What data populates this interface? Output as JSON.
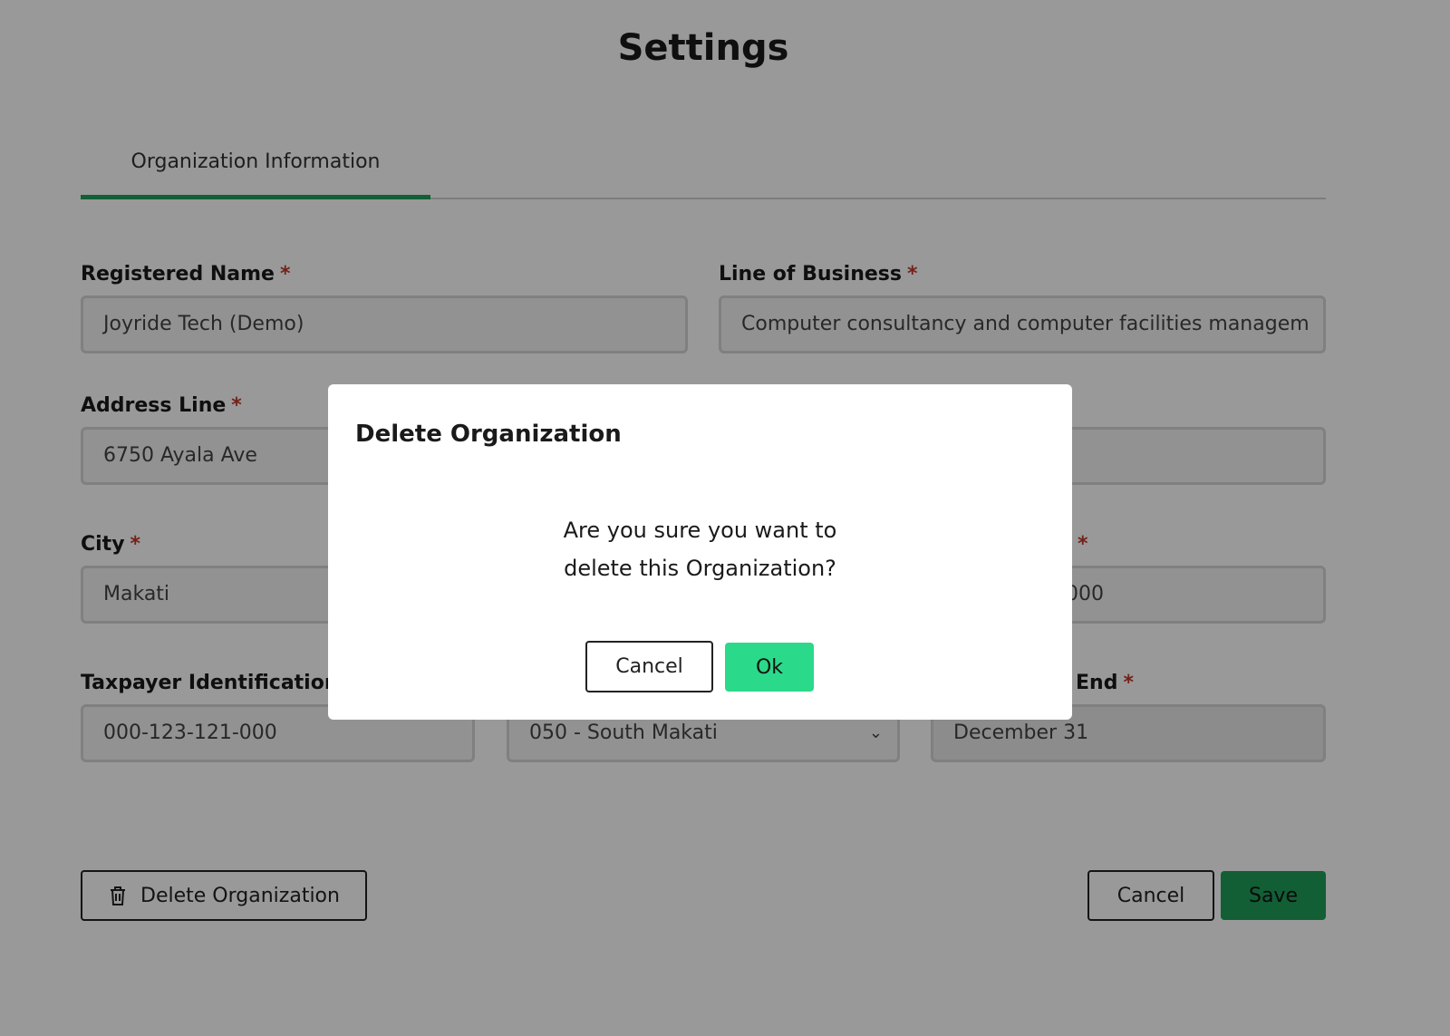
{
  "page": {
    "title": "Settings"
  },
  "tabs": [
    {
      "label": "Organization Information"
    }
  ],
  "form": {
    "registered_name": {
      "label": "Registered Name",
      "required": "*",
      "value": "Joyride Tech (Demo)"
    },
    "line_of_business": {
      "label": "Line of Business",
      "required": "*",
      "value": "Computer consultancy and computer facilities managem"
    },
    "address_line": {
      "label": "Address Line",
      "required": "*",
      "value": "6750 Ayala Ave"
    },
    "address_line_2": {
      "value": ""
    },
    "city": {
      "label": "City",
      "required": "*",
      "value": "Makati"
    },
    "zip_code": {
      "required": "*",
      "value": "000"
    },
    "tin": {
      "label": "Taxpayer Identification N",
      "value": "000-123-121-000"
    },
    "rdo": {
      "value": "050 - South Makati"
    },
    "fiscal_year_end": {
      "label": "End",
      "required": "*",
      "value": "December 31"
    }
  },
  "actions": {
    "delete_label": "Delete Organization",
    "cancel_label": "Cancel",
    "save_label": "Save"
  },
  "modal": {
    "title": "Delete Organization",
    "message_line1": "Are you sure you want to",
    "message_line2": "delete this Organization?",
    "cancel_label": "Cancel",
    "ok_label": "Ok"
  },
  "colors": {
    "accent": "#1e9e5e",
    "ok_button": "#2bd98a",
    "required": "#c0392b"
  },
  "icons": {
    "delete": "trash-icon",
    "select": "chevron-down-icon"
  }
}
